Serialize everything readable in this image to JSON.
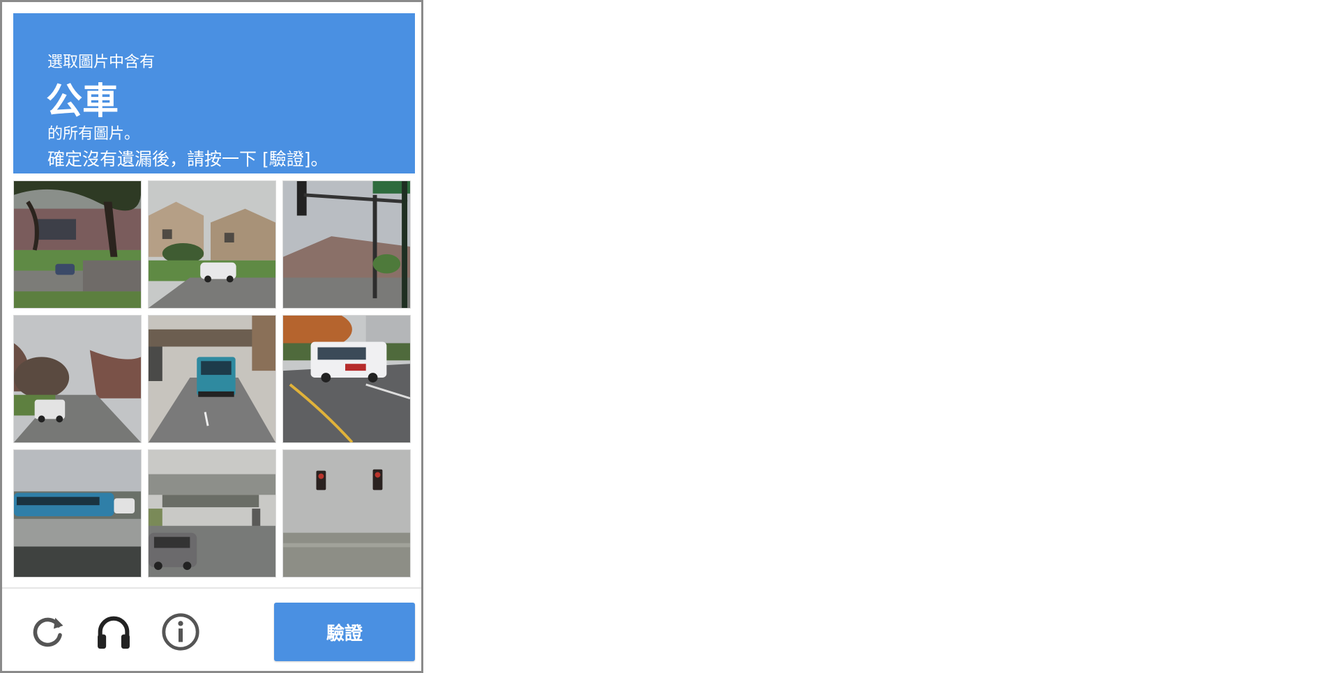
{
  "header": {
    "line1": "選取圖片中含有",
    "keyword": "公車",
    "line2": "的所有圖片。",
    "line3": "確定沒有遺漏後，請按一下 [驗證]。",
    "background_color": "#4a90e2"
  },
  "tiles": [
    {
      "icon": "tree-parking-lot-image"
    },
    {
      "icon": "houses-white-car-image"
    },
    {
      "icon": "traffic-light-street-sign-image"
    },
    {
      "icon": "road-trees-white-truck-image"
    },
    {
      "icon": "bus-under-bridge-image"
    },
    {
      "icon": "shuttle-bus-road-image"
    },
    {
      "icon": "coach-bus-highway-image"
    },
    {
      "icon": "bridge-suv-image"
    },
    {
      "icon": "traffic-lights-image"
    }
  ],
  "footer": {
    "reload_icon": "reload-icon",
    "audio_icon": "headphones-icon",
    "info_icon": "info-icon",
    "verify_label": "驗證",
    "verify_color": "#4a90e2"
  }
}
